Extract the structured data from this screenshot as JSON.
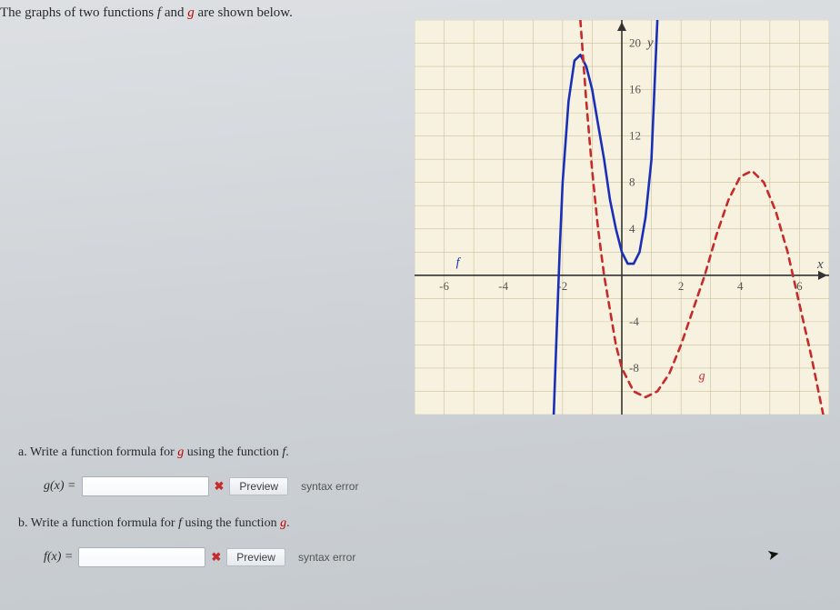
{
  "prompt": {
    "prefix": "The graphs of two functions ",
    "f_label": "f",
    "mid": " and ",
    "g_label": "g",
    "suffix": " are shown below."
  },
  "chart_data": {
    "type": "line",
    "title": "",
    "xlabel": "x",
    "ylabel": "y",
    "xlim": [
      -7,
      7
    ],
    "ylim": [
      -12,
      22
    ],
    "xticks": [
      -6,
      -4,
      -2,
      2,
      4,
      6
    ],
    "yticks": [
      -8,
      -4,
      4,
      8,
      12,
      16,
      20
    ],
    "annotations": {
      "f_label_at": [
        -5.6,
        0.5
      ],
      "g_label_at": [
        2.6,
        -9
      ],
      "x_axis_label": "x",
      "y_axis_label": "y"
    },
    "series": [
      {
        "name": "f",
        "style": "solid",
        "color": "#1a2fb8",
        "x": [
          -2.3,
          -2.2,
          -2.1,
          -2.0,
          -1.8,
          -1.6,
          -1.4,
          -1.2,
          -1.0,
          -0.8,
          -0.6,
          -0.4,
          -0.2,
          0.0,
          0.2,
          0.4,
          0.6,
          0.8,
          1.0,
          1.2
        ],
        "values": [
          -12,
          -5,
          2,
          8,
          15,
          18.5,
          19,
          18,
          16,
          13,
          10,
          6.5,
          4,
          2,
          1,
          1,
          2,
          5,
          10,
          22
        ]
      },
      {
        "name": "g",
        "style": "dashed",
        "color": "#c62a2a",
        "x": [
          -1.4,
          -1.2,
          -1.0,
          -0.8,
          -0.6,
          -0.4,
          -0.2,
          0.0,
          0.4,
          0.8,
          1.2,
          1.6,
          2.0,
          2.4,
          2.8,
          3.2,
          3.6,
          4.0,
          4.4,
          4.8,
          5.2,
          5.6,
          6.0,
          6.4,
          6.8
        ],
        "values": [
          22,
          15,
          9,
          4,
          0,
          -3,
          -6,
          -8,
          -10,
          -10.5,
          -10,
          -8.5,
          -6,
          -3,
          0,
          3.5,
          6.5,
          8.5,
          9,
          8,
          5.5,
          2,
          -2.5,
          -7,
          -12
        ]
      }
    ]
  },
  "questions": {
    "a": {
      "text_prefix": "a. Write a function formula for ",
      "g": "g",
      "mid": " using the function ",
      "f": "f",
      "suffix": ".",
      "lhs_open": "g(x) = ",
      "placeholder": "",
      "mark": "✖",
      "preview": "Preview",
      "error": "syntax error"
    },
    "b": {
      "text_prefix": "b. Write a function formula for ",
      "f": "f",
      "mid": " using the function ",
      "g": "g",
      "suffix": ".",
      "lhs_open": "f(x) = ",
      "placeholder": "",
      "mark": "✖",
      "preview": "Preview",
      "error": "syntax error"
    }
  }
}
